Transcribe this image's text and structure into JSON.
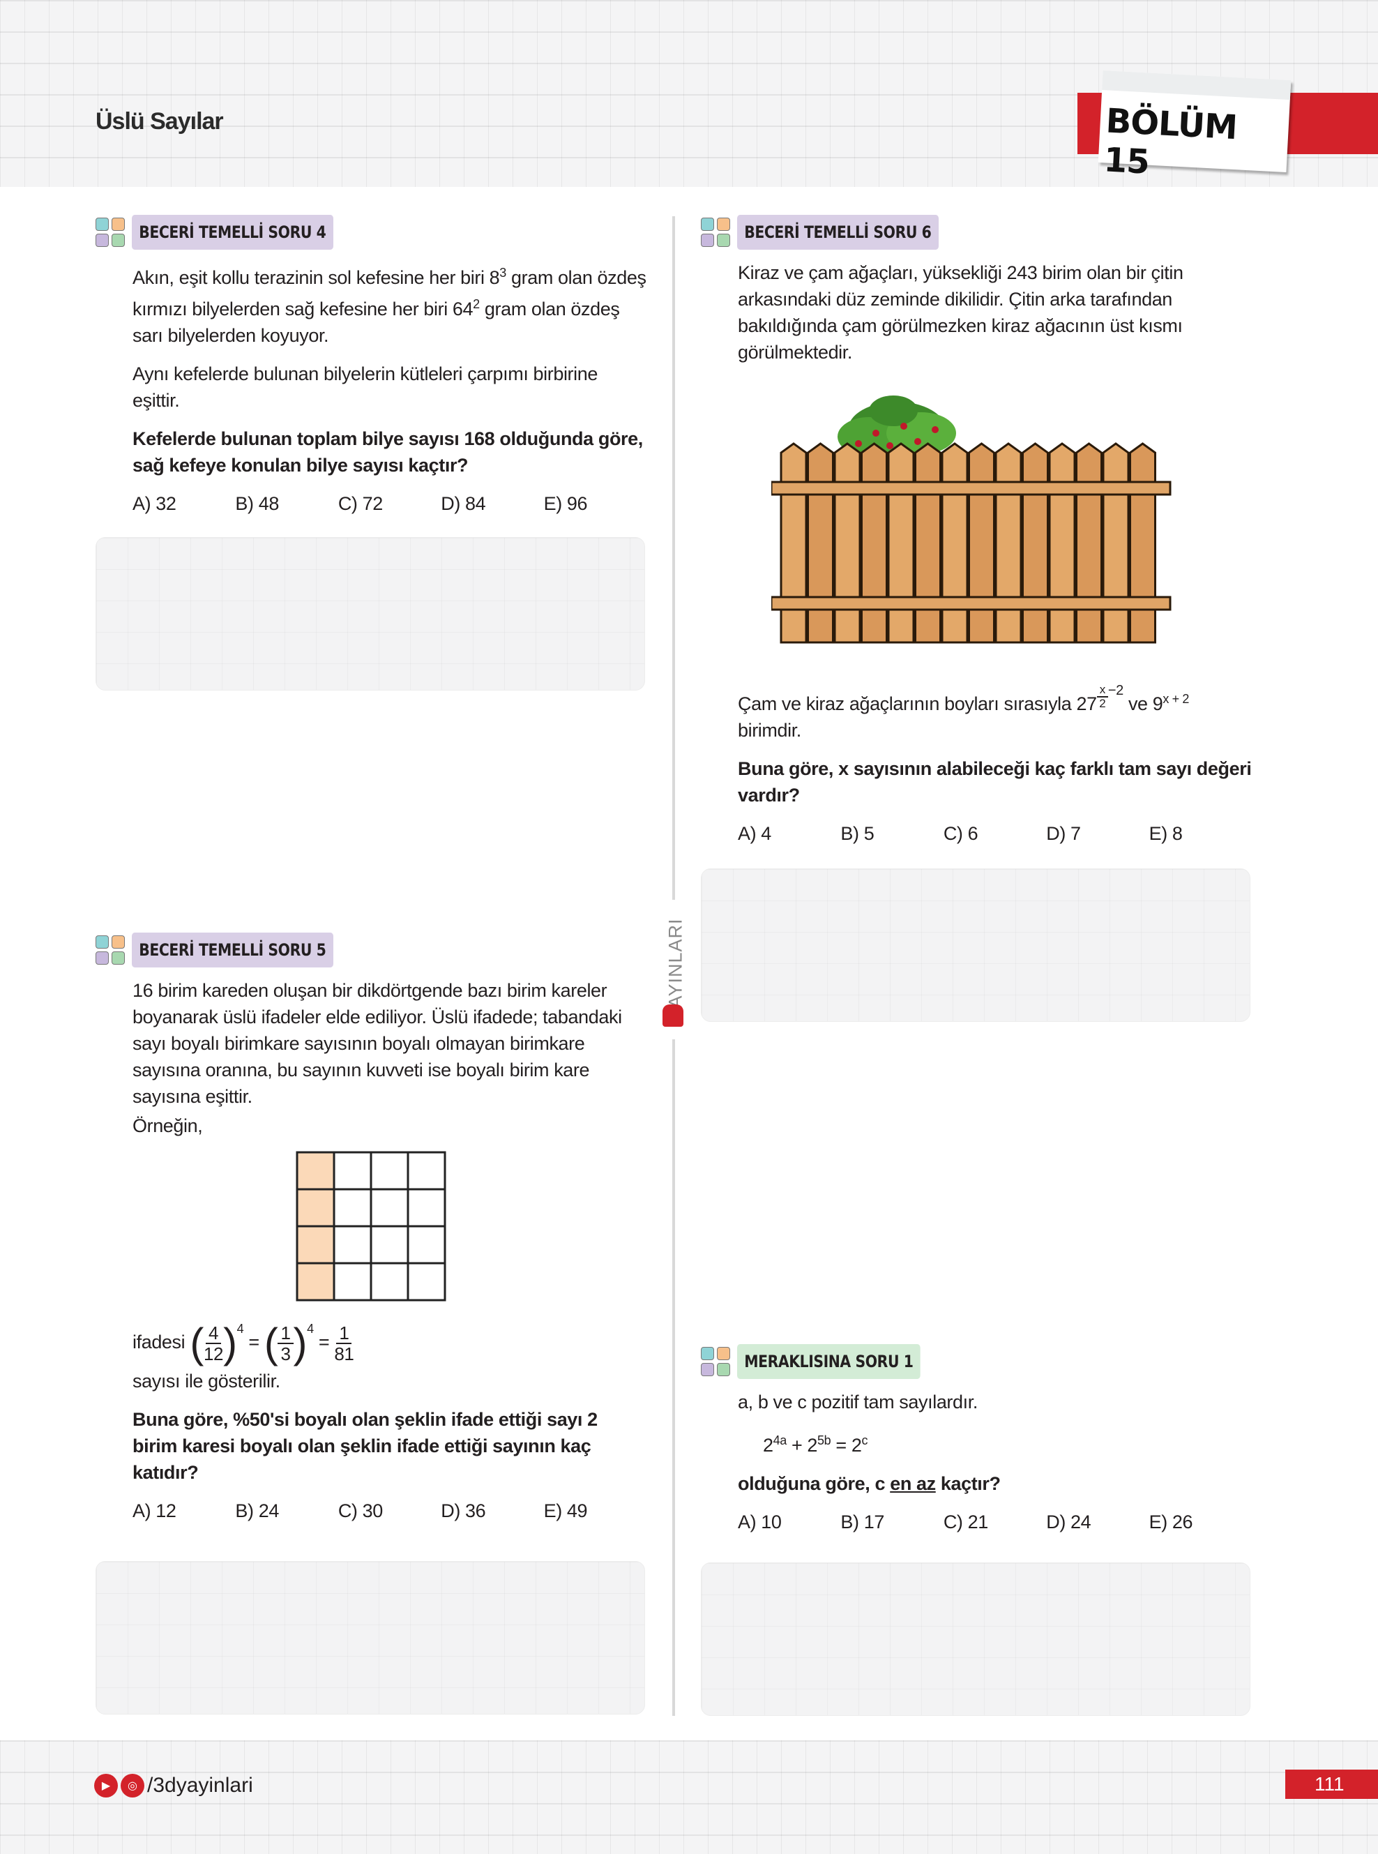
{
  "header": {
    "title": "Üslü Sayılar",
    "chapter": "BÖLÜM 15"
  },
  "publisher_vertical": "YAYINLARI",
  "colors": {
    "accent": "#d3222a",
    "label_purple": "#d9cfe6",
    "label_green": "#d3ecd6"
  },
  "q4": {
    "label": "BECERİ TEMELLİ SORU 4",
    "p1a": "Akın, eşit kollu terazinin sol kefesine her biri 8",
    "p1sup1": "3",
    "p1b": " gram olan özdeş kırmızı bilyelerden sağ kefesine her biri 64",
    "p1sup2": "2",
    "p1c": " gram olan özdeş sarı bilyelerden koyuyor.",
    "p2": "Aynı kefelerde bulunan bilyelerin kütleleri çarpımı birbirine eşittir.",
    "question": "Kefelerde bulunan toplam bilye sayısı 168 olduğunda göre, sağ kefeye konulan bilye sayısı kaçtır?",
    "answers": [
      "A) 32",
      "B) 48",
      "C) 72",
      "D) 84",
      "E) 96"
    ]
  },
  "q5": {
    "label": "BECERİ TEMELLİ SORU 5",
    "p1": "16 birim kareden oluşan bir dikdörtgende bazı birim kareler boyanarak üslü ifadeler elde ediliyor. Üslü ifadede; tabandaki sayı boyalı birimkare sayısının boyalı olmayan birimkare sayısına oranına, bu sayının kuvveti ise boyalı birim kare sayısına eşittir.",
    "p2": "Örneğin,",
    "formula": {
      "prefix": "ifadesi",
      "f1n": "4",
      "f1d": "12",
      "e1": "4",
      "eq": "=",
      "f2n": "1",
      "f2d": "3",
      "e2": "4",
      "f3n": "1",
      "f3d": "81"
    },
    "p3": "sayısı ile gösterilir.",
    "question": "Buna göre, %50'si boyalı olan şeklin ifade ettiği sayı 2 birim karesi boyalı olan şeklin ifade ettiği sayının kaç katıdır?",
    "answers": [
      "A) 12",
      "B) 24",
      "C) 30",
      "D) 36",
      "E) 49"
    ]
  },
  "q6": {
    "label": "BECERİ TEMELLİ SORU 6",
    "p1": "Kiraz ve çam ağaçları, yüksekliği 243 birim olan bir çitin arkasındaki düz zeminde dikilidir. Çitin arka tarafından bakıldığında çam görülmezken kiraz ağacının üst kısmı görülmektedir.",
    "p2a": "Çam ve kiraz ağaçlarının boyları sırasıyla 27",
    "p2exp_n": "x",
    "p2exp_d": "2",
    "p2exp_rest": "−2",
    "p2b": " ve 9",
    "p2sup": "x + 2",
    "p2c": " birimdir.",
    "question": "Buna göre, x sayısının alabileceği kaç farklı tam sayı değeri vardır?",
    "answers": [
      "A) 4",
      "B) 5",
      "C) 6",
      "D) 7",
      "E) 8"
    ]
  },
  "m1": {
    "label": "MERAKLISINA SORU 1",
    "p1": "a, b ve c pozitif tam sayılardır.",
    "eq": {
      "b1": "2",
      "e1": "4a",
      "plus": " + 2",
      "e2": "5b",
      "eqs": " = 2",
      "e3": "c"
    },
    "q_a": "olduğuna göre, c ",
    "q_u": "en az",
    "q_b": " kaçtır?",
    "answers": [
      "A) 10",
      "B) 17",
      "C) 21",
      "D) 24",
      "E) 26"
    ]
  },
  "footer": {
    "social": "/3dyayinlari",
    "page": "111",
    "icons": [
      "youtube-icon",
      "instagram-icon"
    ]
  }
}
